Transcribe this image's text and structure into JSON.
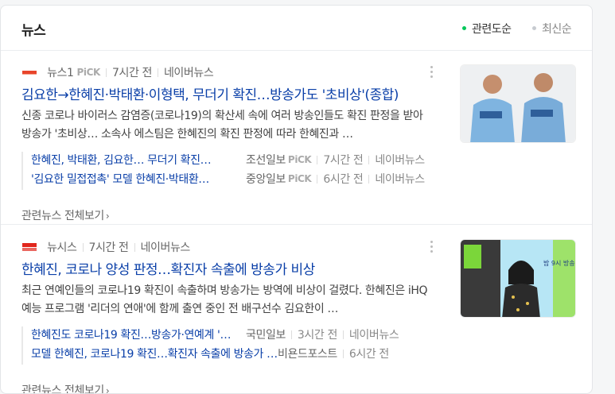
{
  "header": {
    "title": "뉴스",
    "sort_relevance": "관련도순",
    "sort_latest": "최신순"
  },
  "articles": [
    {
      "source": "뉴스1",
      "pick": "PiCK",
      "time": "7시간 전",
      "portal": "네이버뉴스",
      "headline": "김요한→한혜진·박태환·이형택, 무더기 확진…방송가도 '초비상'(종합)",
      "summary": "신종 코로나 바이러스 감염증(코로나19)의 확산세 속에 여러 방송인들도 확진 판정을 받아 방송가 '초비상… 소속사 에스팀은 한혜진의 확진 판정에 따라 한혜진과 …",
      "related": [
        {
          "title": "한혜진, 박태환, 김요한… 무더기 확진…",
          "source": "조선일보",
          "pick": "PiCK",
          "time": "7시간 전",
          "portal": "네이버뉴스"
        },
        {
          "title": "'김요한 밀접접촉' 모델 한혜진·박태환…",
          "source": "중앙일보",
          "pick": "PiCK",
          "time": "6시간 전",
          "portal": "네이버뉴스"
        }
      ],
      "see_all": "관련뉴스 전체보기"
    },
    {
      "source": "뉴시스",
      "pick": "",
      "time": "7시간 전",
      "portal": "네이버뉴스",
      "headline": "한혜진, 코로나 양성 판정…확진자 속출에 방송가 비상",
      "summary": "최근 연예인들의 코로나19 확진이 속출하며 방송가는 방역에 비상이 걸렸다. 한혜진은 iHQ 예능 프로그램 '리더의 연애'에 함께 출연 중인 전 배구선수 김요한이 …",
      "related": [
        {
          "title": "한혜진도 코로나19 확진…방송가·연예계 '…",
          "source": "국민일보",
          "pick": "",
          "time": "3시간 전",
          "portal": "네이버뉴스"
        },
        {
          "title": "모델 한혜진, 코로나19 확진…확진자 속출에 방송가 …",
          "source": "비욘드포스트",
          "pick": "",
          "time": "6시간 전",
          "portal": ""
        }
      ],
      "see_all": "관련뉴스 전체보기"
    }
  ],
  "thumb2_caption": "밤 9시 방송",
  "colors": {
    "link": "#0a3fa8",
    "accent_green": "#03c75a"
  }
}
